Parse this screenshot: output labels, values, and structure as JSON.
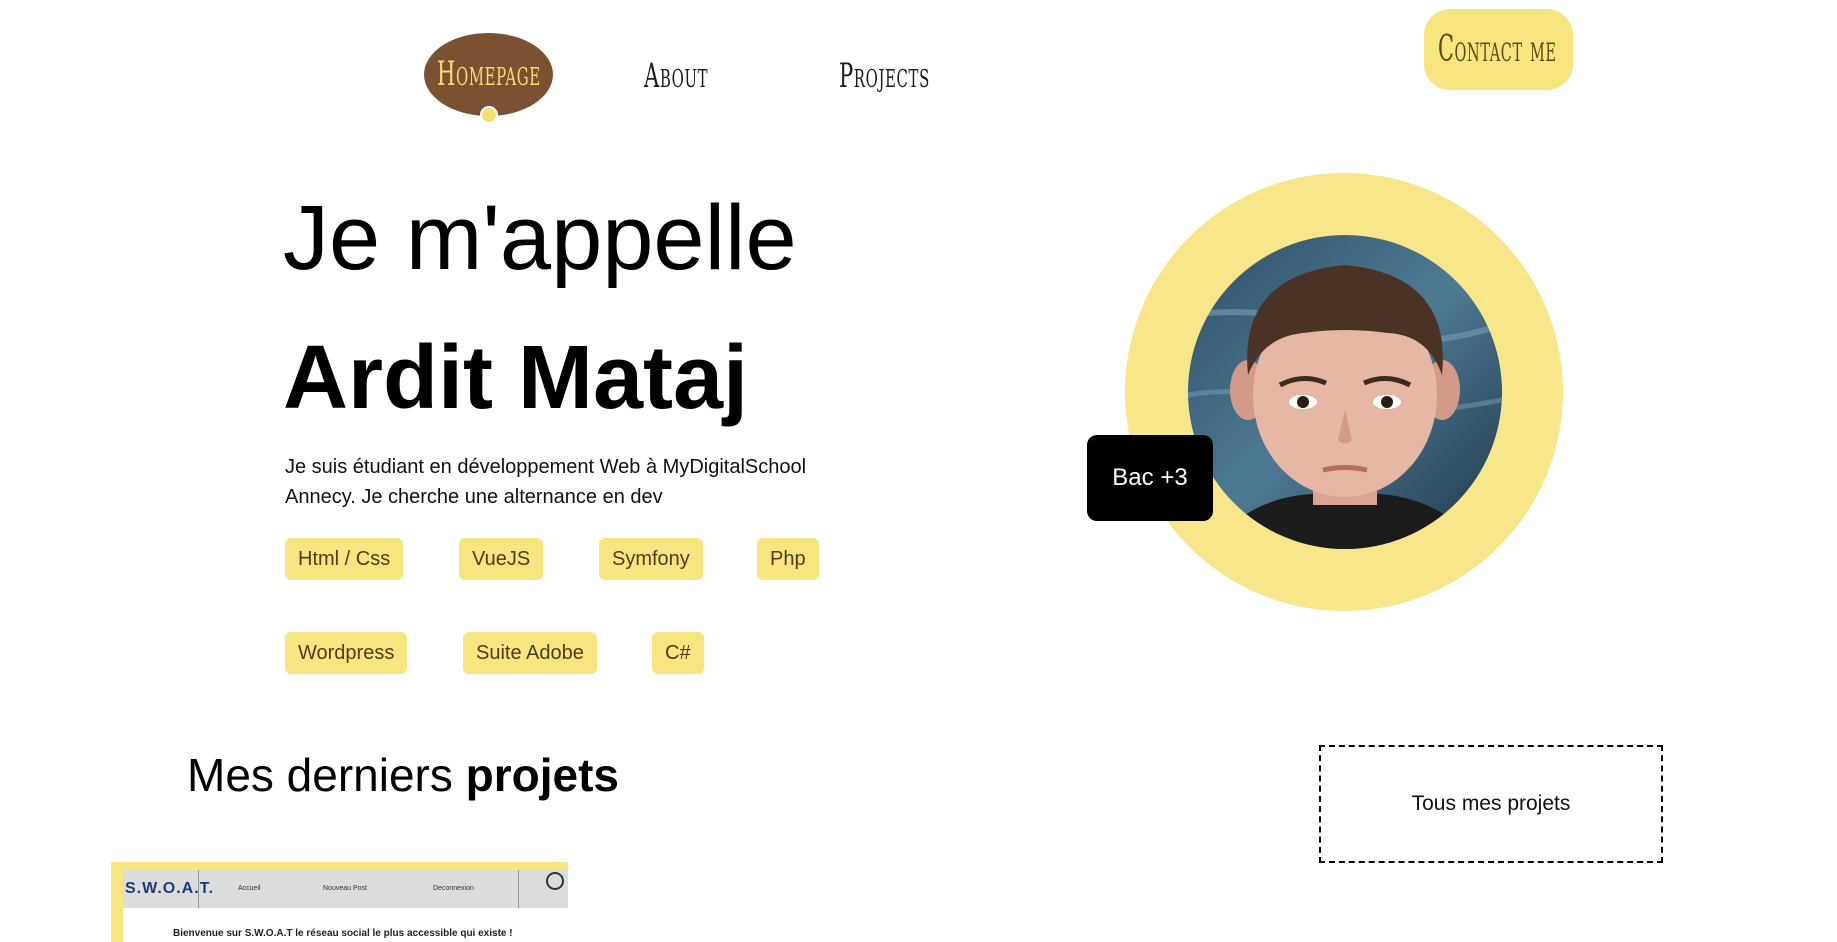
{
  "nav": {
    "home": "Homepage",
    "about": "About",
    "projects": "Projects",
    "contact": "Contact me"
  },
  "hero": {
    "greeting": "Je m'appelle",
    "name": "Ardit Mataj",
    "description": "Je suis étudiant en développement Web à MyDigitalSchool Annecy. Je cherche une alternance en dev",
    "badge": "Bac +3"
  },
  "skills": [
    "Html / Css",
    "VueJS",
    "Symfony",
    "Php",
    "Wordpress",
    "Suite Adobe",
    "C#"
  ],
  "projects": {
    "heading_regular": "Mes derniers ",
    "heading_bold": "projets",
    "all_button": "Tous mes projets",
    "preview": {
      "logo": "S.W.O.A.T.",
      "links": [
        "Accueil",
        "Nouveau Post",
        "Deconnexion"
      ],
      "welcome": "Bienvenue sur S.W.O.A.T le réseau social le plus accessible qui existe !"
    }
  },
  "colors": {
    "accent_yellow": "#f7e57f",
    "home_brown": "#7a5232",
    "badge_black": "#000000"
  }
}
